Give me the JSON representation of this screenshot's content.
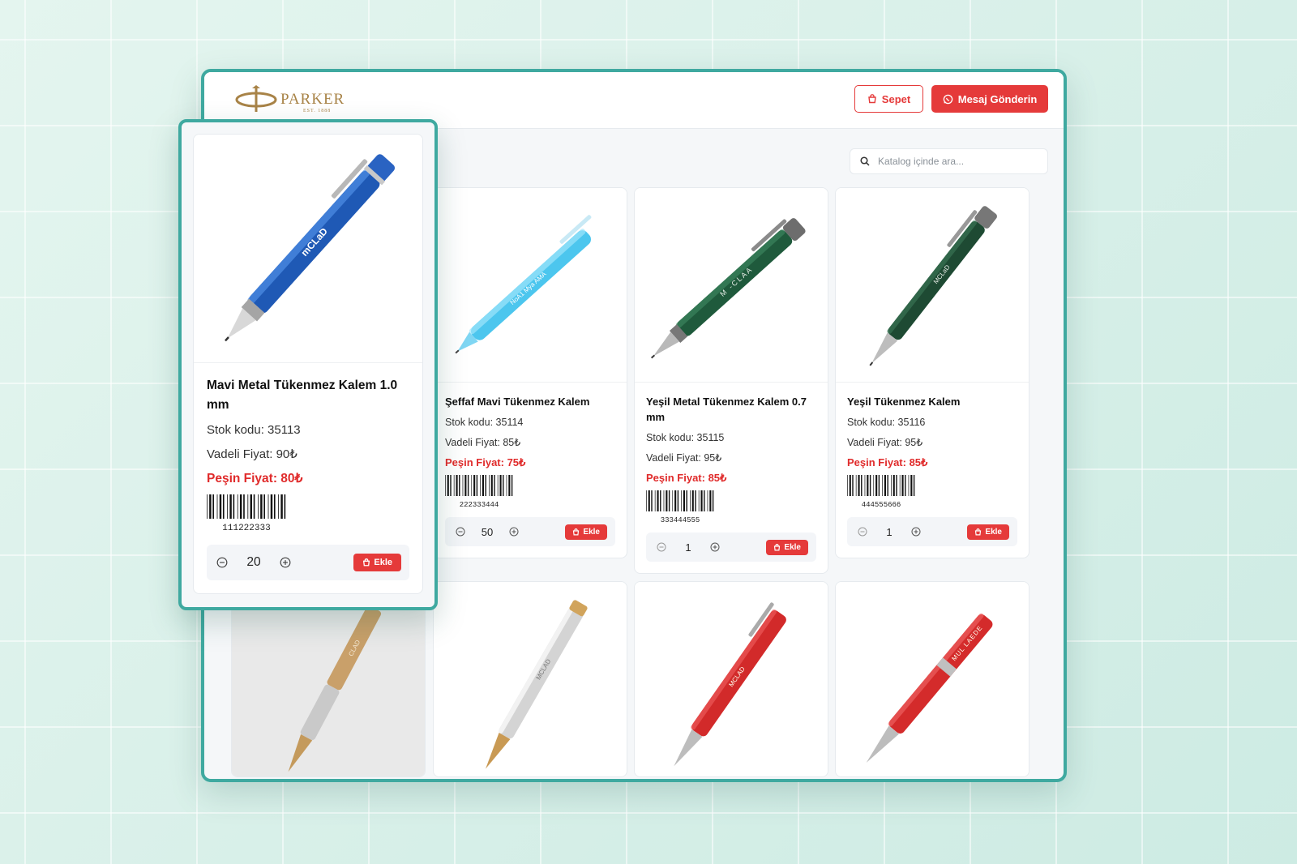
{
  "header": {
    "logo_text": "PARKER",
    "logo_sub": "EST. 1888",
    "cart_label": "Sepet",
    "message_label": "Mesaj Gönderin"
  },
  "search": {
    "placeholder": "Katalog içinde ara..."
  },
  "products": [
    {
      "name": "Mavi Metal Tükenmez Kalem 1.0 mm",
      "stock": "Stok kodu: 35113",
      "vadeli": "Vadeli Fiyat: 90₺",
      "pesin": "Peşin Fiyat: 80₺",
      "barcode": "111222333",
      "qty": "20",
      "add_label": "Ekle",
      "engraving": "mCLaD"
    },
    {
      "name": "Şeffaf Mavi Tükenmez Kalem",
      "stock": "Stok kodu: 35114",
      "vadeli": "Vadeli Fiyat: 85₺",
      "pesin": "Peşin Fiyat: 75₺",
      "barcode": "222333444",
      "qty": "50",
      "add_label": "Ekle",
      "engraving": "NoA1 Mya AMA"
    },
    {
      "name": "Yeşil Metal Tükenmez Kalem 0.7 mm",
      "stock": "Stok kodu: 35115",
      "vadeli": "Vadeli Fiyat: 95₺",
      "pesin": "Peşin Fiyat: 85₺",
      "barcode": "333444555",
      "qty": "1",
      "add_label": "Ekle",
      "engraving": "M -CLAA"
    },
    {
      "name": "Yeşil Tükenmez Kalem",
      "stock": "Stok kodu: 35116",
      "vadeli": "Vadeli Fiyat: 95₺",
      "pesin": "Peşin Fiyat: 85₺",
      "barcode": "444555666",
      "qty": "1",
      "add_label": "Ekle",
      "engraving": "MCLaD"
    }
  ],
  "row2": [
    {
      "engraving": "CLAD"
    },
    {
      "engraving": "MCLAD"
    },
    {
      "engraving": "MCLAD"
    },
    {
      "engraving": "MUL LAEDE"
    }
  ],
  "colors": {
    "accent": "#e53a3a",
    "frame": "#3fa9a0",
    "brand_gold": "#a88347"
  },
  "icons": {
    "cart": "cart-icon",
    "whatsapp": "whatsapp-icon",
    "search": "search-icon",
    "minus": "minus-circle-icon",
    "plus": "plus-circle-icon"
  }
}
